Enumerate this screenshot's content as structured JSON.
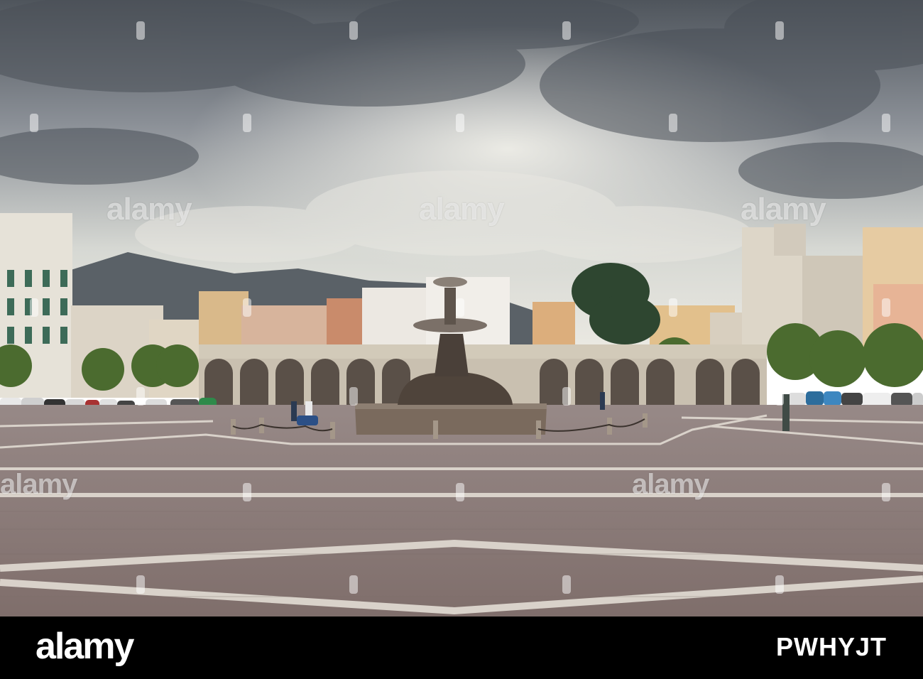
{
  "scene": {
    "subject": "town-square-with-fountain",
    "colors": {
      "sky_dark": "#5f656d",
      "sky_light": "#dfe1de",
      "pavement": "#8c7b78",
      "pavement_lines": "#d9d2ca",
      "aqueduct": "#c9c0b0",
      "fountain": "#6e6257"
    }
  },
  "watermark": {
    "text": "alamy"
  },
  "footer": {
    "logo": "alamy",
    "image_id": "PWHYJT"
  }
}
